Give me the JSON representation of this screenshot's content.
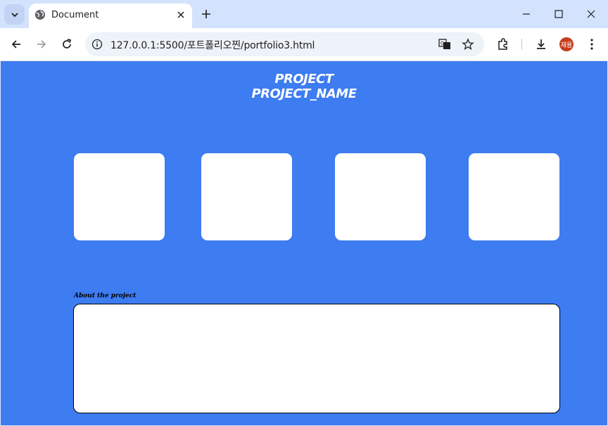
{
  "browser": {
    "tab_title": "Document",
    "url": "127.0.0.1:5500/포트폴리오찐/portfolio3.html",
    "profile_label": "재용"
  },
  "page": {
    "heading_line1": "PROJECT",
    "heading_line2": "PROJECT_NAME",
    "about_label": "About the project",
    "cards_count": 4,
    "colors": {
      "background": "#3d7cf1",
      "card": "#ffffff",
      "text": "#ffffff"
    }
  }
}
